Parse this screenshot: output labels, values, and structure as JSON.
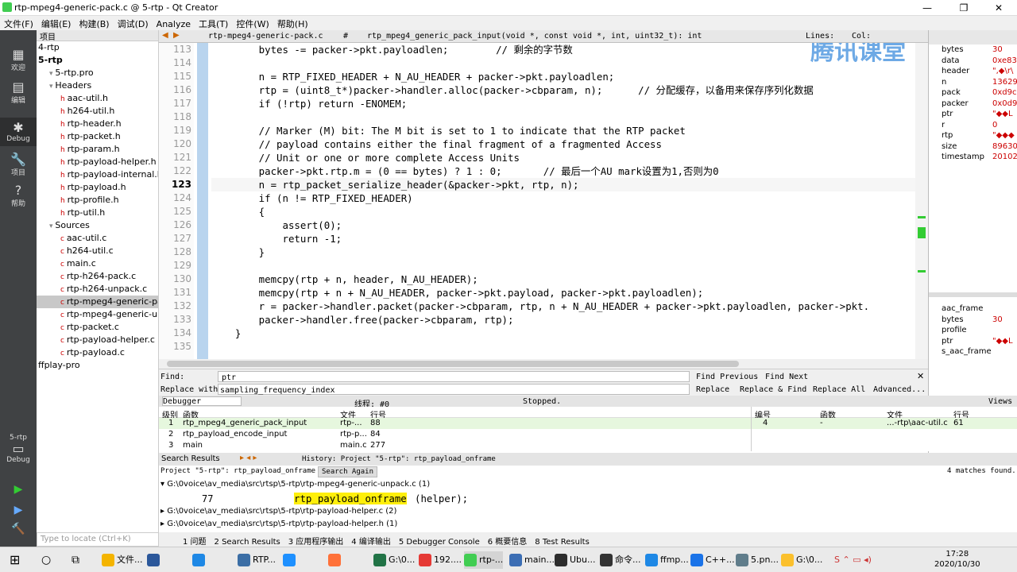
{
  "window": {
    "title": "rtp-mpeg4-generic-pack.c @ 5-rtp - Qt Creator",
    "min": "—",
    "max": "❐",
    "close": "✕"
  },
  "menu": [
    "文件(F)",
    "编辑(E)",
    "构建(B)",
    "调试(D)",
    "Analyze",
    "工具(T)",
    "控件(W)",
    "帮助(H)"
  ],
  "modes": [
    {
      "label": "欢迎",
      "icon": "▦"
    },
    {
      "label": "编辑",
      "icon": "▤"
    },
    {
      "label": "Debug",
      "icon": "✱"
    },
    {
      "label": "项目",
      "icon": "🔧"
    },
    {
      "label": "帮助",
      "icon": "?"
    }
  ],
  "kit": {
    "project": "5-rtp",
    "mode": "Debug",
    "run": "▶",
    "debug": "▶",
    "build": "🔨"
  },
  "project": {
    "header": "项目",
    "tree": [
      "4-rtp",
      "5-rtp",
      "5-rtp.pro",
      "Headers",
      "aac-util.h",
      "h264-util.h",
      "rtp-header.h",
      "rtp-packet.h",
      "rtp-param.h",
      "rtp-payload-helper.h",
      "rtp-payload-internal.h",
      "rtp-payload.h",
      "rtp-profile.h",
      "rtp-util.h",
      "Sources",
      "aac-util.c",
      "h264-util.c",
      "main.c",
      "rtp-h264-pack.c",
      "rtp-h264-unpack.c",
      "rtp-mpeg4-generic-pack.c",
      "rtp-mpeg4-generic-unpack.c",
      "rtp-packet.c",
      "rtp-payload-helper.c",
      "rtp-payload.c",
      "ffplay-pro"
    ]
  },
  "editor": {
    "file": "rtp-mpeg4-generic-pack.c",
    "symbol": "rtp_mpeg4_generic_pack_input(void *, const void *, int, uint32_t): int",
    "lines_label": "Lines: ",
    "col_label": "Col: ",
    "line_numbers": [
      "113",
      "114",
      "115",
      "116",
      "117",
      "118",
      "119",
      "120",
      "121",
      "122",
      "123",
      "124",
      "125",
      "126",
      "127",
      "128",
      "129",
      "130",
      "131",
      "132",
      "133",
      "134",
      "135"
    ],
    "code": [
      "        bytes -= packer->pkt.payloadlen;        // 剩余的字节数",
      "",
      "        n = RTP_FIXED_HEADER + N_AU_HEADER + packer->pkt.payloadlen;",
      "        rtp = (uint8_t*)packer->handler.alloc(packer->cbparam, n);      // 分配缓存，以备用来保存序列化数据",
      "        if (!rtp) return -ENOMEM;",
      "",
      "        // Marker (M) bit: The M bit is set to 1 to indicate that the RTP packet",
      "        // payload contains either the final fragment of a fragmented Access",
      "        // Unit or one or more complete Access Units",
      "        packer->pkt.rtp.m = (0 == bytes) ? 1 : 0;       // 最后一个AU mark设置为1,否则为0",
      "        n = rtp_packet_serialize_header(&packer->pkt, rtp, n);",
      "        if (n != RTP_FIXED_HEADER)",
      "        {",
      "            assert(0);",
      "            return -1;",
      "        }",
      "",
      "        memcpy(rtp + n, header, N_AU_HEADER);",
      "        memcpy(rtp + n + N_AU_HEADER, packer->pkt.payload, packer->pkt.payloadlen);",
      "        r = packer->handler.packet(packer->cbparam, rtp, n + N_AU_HEADER + packer->pkt.payloadlen, packer->pkt.",
      "        packer->handler.free(packer->cbparam, rtp);",
      "    }",
      ""
    ]
  },
  "watermark": "腾讯课堂",
  "locals": [
    {
      "name": "bytes",
      "value": "30"
    },
    {
      "name": "data",
      "value": "0xe83"
    },
    {
      "name": "header",
      "value": "\",◆\\r\\"
    },
    {
      "name": "n",
      "value": "13629"
    },
    {
      "name": "pack",
      "value": "0xd9c"
    },
    {
      "name": "packer",
      "value": "0x0d9"
    },
    {
      "name": "ptr",
      "value": "\"◆◆L"
    },
    {
      "name": "r",
      "value": "0"
    },
    {
      "name": "rtp",
      "value": "\"◆◆◆"
    },
    {
      "name": "size",
      "value": "89630"
    },
    {
      "name": "timestamp",
      "value": "20102"
    }
  ],
  "watches": [
    {
      "name": "aac_frame",
      "value": ""
    },
    {
      "name": "bytes",
      "value": "30"
    },
    {
      "name": "profile",
      "value": ""
    },
    {
      "name": "ptr",
      "value": "\"◆◆L"
    },
    {
      "name": "s_aac_frame",
      "value": ""
    }
  ],
  "find": {
    "find_label": "Find:",
    "find_value": "ptr",
    "replace_label": "Replace with:",
    "replace_value": "sampling_frequency_index",
    "find_prev": "Find Previous",
    "find_next": "Find Next",
    "replace": "Replace",
    "replace_find": "Replace & Find",
    "replace_all": "Replace All",
    "advanced": "Advanced..."
  },
  "debugger": {
    "label": "Debugger",
    "thread": "线程: #0",
    "status": "Stopped.",
    "views": "Views"
  },
  "stack": {
    "headers": [
      "级别",
      "函数",
      "文件",
      "行号"
    ],
    "rows": [
      [
        "1",
        "rtp_mpeg4_generic_pack_input",
        "rtp-...",
        "88"
      ],
      [
        "2",
        "rtp_payload_encode_input",
        "rtp-p...",
        "84"
      ],
      [
        "3",
        "main",
        "main.c",
        "277"
      ]
    ]
  },
  "breakpoints": {
    "headers": [
      "编号",
      "函数",
      "文件",
      "行号"
    ],
    "rows": [
      [
        "4",
        "-",
        "...-rtp\\aac-util.c",
        "61"
      ]
    ]
  },
  "search": {
    "title": "Search Results",
    "history": "History: Project \"5-rtp\": rtp_payload_onframe",
    "project": "Project \"5-rtp\": rtp_payload_onframe",
    "again": "Search Again",
    "found": "4 matches found.",
    "files": [
      "G:\\0voice\\av_media\\src\\rtsp\\5-rtp\\rtp-mpeg4-generic-unpack.c (1)",
      "G:\\0voice\\av_media\\src\\rtsp\\5-rtp\\rtp-payload-helper.c (2)",
      "G:\\0voice\\av_media\\src\\rtsp\\5-rtp\\rtp-payload-helper.h (1)"
    ],
    "line": "77",
    "match": "rtp_payload_onframe",
    "rest": "(helper);"
  },
  "locator": "Type to locate (Ctrl+K)",
  "status_tabs": [
    "1 问题",
    "2 Search Results",
    "3 应用程序输出",
    "4 编译输出",
    "5 Debugger Console",
    "6 概要信息",
    "8 Test Results"
  ],
  "taskbar": {
    "items": [
      "文件...",
      "",
      "",
      "RTP...",
      "",
      "",
      "G:\\0...",
      "192....",
      "rtp-...",
      "main...",
      "Ubu...",
      "命令...",
      "ffmp...",
      "C++...",
      "5.pn...",
      "G:\\0..."
    ],
    "time": "17:28",
    "date": "2020/10/30"
  }
}
